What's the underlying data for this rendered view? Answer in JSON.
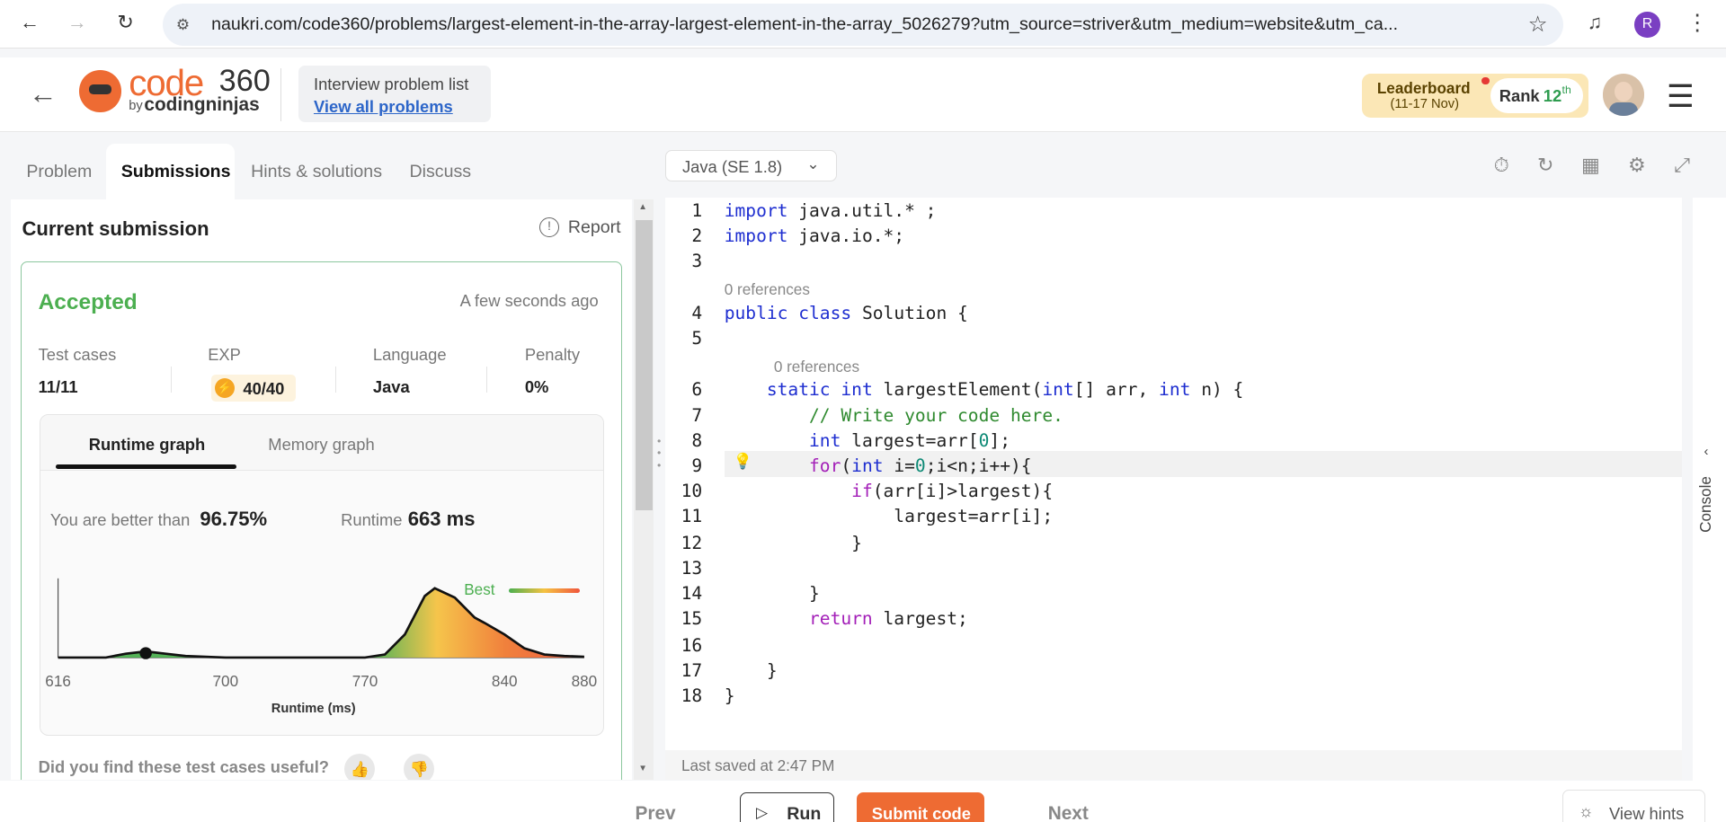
{
  "browser": {
    "url": "naukri.com/code360/problems/largest-element-in-the-array-largest-element-in-the-array_5026279?utm_source=striver&utm_medium=website&utm_ca...",
    "profile_initial": "R"
  },
  "header": {
    "logo_code": "code",
    "logo_360": "360",
    "logo_by": "by",
    "logo_cn": "codingninjas",
    "problem_list_title": "Interview problem list",
    "problem_list_link": "View all problems",
    "leaderboard_label": "Leaderboard",
    "leaderboard_dates": "(11-17 Nov)",
    "rank_label": "Rank",
    "rank_value": "12",
    "rank_suffix": "th"
  },
  "tabs": [
    "Problem",
    "Submissions",
    "Hints & solutions",
    "Discuss"
  ],
  "submission": {
    "title": "Current submission",
    "report": "Report",
    "status": "Accepted",
    "time": "A few seconds ago",
    "stats": {
      "test_cases_label": "Test cases",
      "test_cases_value": "11/11",
      "exp_label": "EXP",
      "exp_value": "40/40",
      "language_label": "Language",
      "language_value": "Java",
      "penalty_label": "Penalty",
      "penalty_value": "0%"
    },
    "graph_tabs": [
      "Runtime graph",
      "Memory graph"
    ],
    "better_than_label": "You are better than",
    "better_than_value": "96.75%",
    "runtime_label": "Runtime",
    "runtime_value": "663 ms",
    "best_label": "Best",
    "feedback_question": "Did you find these test cases useful?"
  },
  "chart_data": {
    "type": "area",
    "xlabel": "Runtime (ms)",
    "x_ticks": [
      "616",
      "700",
      "770",
      "840",
      "880"
    ],
    "xlim": [
      616,
      880
    ],
    "marker_x": 660,
    "series": [
      {
        "x": [
          616,
          640,
          650,
          660,
          670,
          680,
          700,
          740,
          770,
          780,
          790,
          800,
          805,
          815,
          825,
          830,
          840,
          850,
          860,
          870,
          880
        ],
        "y": [
          0,
          0,
          0.05,
          0.08,
          0.05,
          0.02,
          0,
          0,
          0,
          0.04,
          0.3,
          0.8,
          0.9,
          0.78,
          0.52,
          0.45,
          0.3,
          0.12,
          0.04,
          0.02,
          0.01
        ]
      }
    ]
  },
  "editor": {
    "language": "Java (SE 1.8)",
    "ref_text": "0 references",
    "last_saved": "Last saved at 2:47 PM",
    "console": "Console"
  },
  "bottom": {
    "prev": "Prev",
    "run": "Run",
    "submit": "Submit code",
    "next": "Next",
    "hints": "View hints"
  },
  "colors": {
    "accent": "#ee6b33",
    "accepted": "#4caf50",
    "keyword": "#1e2ed0"
  }
}
